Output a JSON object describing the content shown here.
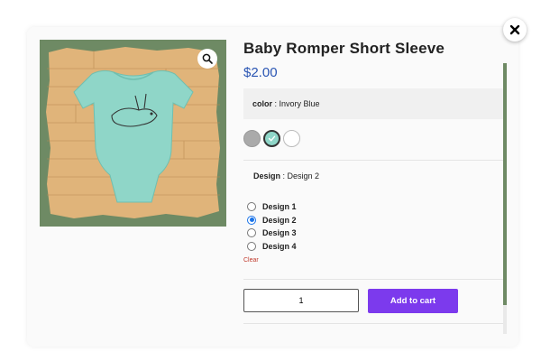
{
  "product": {
    "title": "Baby Romper Short Sleeve",
    "price": "$2.00"
  },
  "color_attribute": {
    "label": "color",
    "value": "Invory Blue",
    "swatches": [
      "gray",
      "mint",
      "white"
    ],
    "selected_swatch": "mint"
  },
  "design_attribute": {
    "label": "Design",
    "value": "Design 2",
    "options": [
      "Design 1",
      "Design 2",
      "Design 3",
      "Design 4"
    ],
    "selected": "Design 2",
    "clear_label": "Clear"
  },
  "cart": {
    "quantity": "1",
    "add_label": "Add to cart"
  },
  "icons": {
    "close": "close-icon",
    "zoom": "magnifier-icon",
    "check": "check-icon"
  },
  "colors": {
    "accent": "#7c3aed",
    "price": "#2a55b3",
    "image_background": "#6e8a64",
    "clear_link": "#c0392b"
  }
}
